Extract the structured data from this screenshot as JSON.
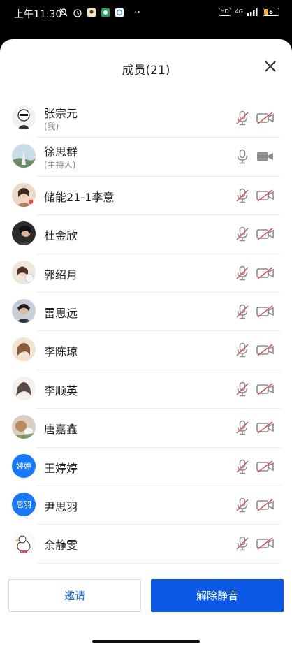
{
  "status_bar": {
    "time": "上午11:30",
    "network": "4G",
    "hd": "HD",
    "battery": "6",
    "more": "··"
  },
  "sheet": {
    "title": "成员(21)",
    "close_icon": "close-icon"
  },
  "members": [
    {
      "name": "张宗元",
      "sub": "(我)",
      "avatar": "photo",
      "mic": "muted",
      "cam": "off"
    },
    {
      "name": "徐思群",
      "sub": "(主持人)",
      "avatar": "photo",
      "mic": "on",
      "cam": "on"
    },
    {
      "name": "储能21-1李意",
      "sub": "",
      "avatar": "photo",
      "mic": "muted",
      "cam": "off"
    },
    {
      "name": "杜金欣",
      "sub": "",
      "avatar": "photo",
      "mic": "muted",
      "cam": "off"
    },
    {
      "name": "郭绍月",
      "sub": "",
      "avatar": "photo",
      "mic": "muted",
      "cam": "off"
    },
    {
      "name": "雷思远",
      "sub": "",
      "avatar": "photo",
      "mic": "muted",
      "cam": "off"
    },
    {
      "name": "李陈琼",
      "sub": "",
      "avatar": "photo",
      "mic": "muted",
      "cam": "off"
    },
    {
      "name": "李顺英",
      "sub": "",
      "avatar": "photo",
      "mic": "muted",
      "cam": "off"
    },
    {
      "name": "唐嘉鑫",
      "sub": "",
      "avatar": "photo",
      "mic": "muted",
      "cam": "off"
    },
    {
      "name": "王婷婷",
      "sub": "",
      "avatar_text": "婷婷",
      "mic": "muted",
      "cam": "off"
    },
    {
      "name": "尹思羽",
      "sub": "",
      "avatar_text": "思羽",
      "mic": "muted",
      "cam": "off"
    },
    {
      "name": "余静雯",
      "sub": "",
      "avatar": "photo",
      "mic": "muted",
      "cam": "off"
    }
  ],
  "footer": {
    "invite_label": "邀请",
    "unmute_all_label": "解除静音"
  },
  "colors": {
    "accent": "#0a58e3",
    "muted_red": "#e5484d",
    "icon_gray": "#8c8c8c"
  }
}
